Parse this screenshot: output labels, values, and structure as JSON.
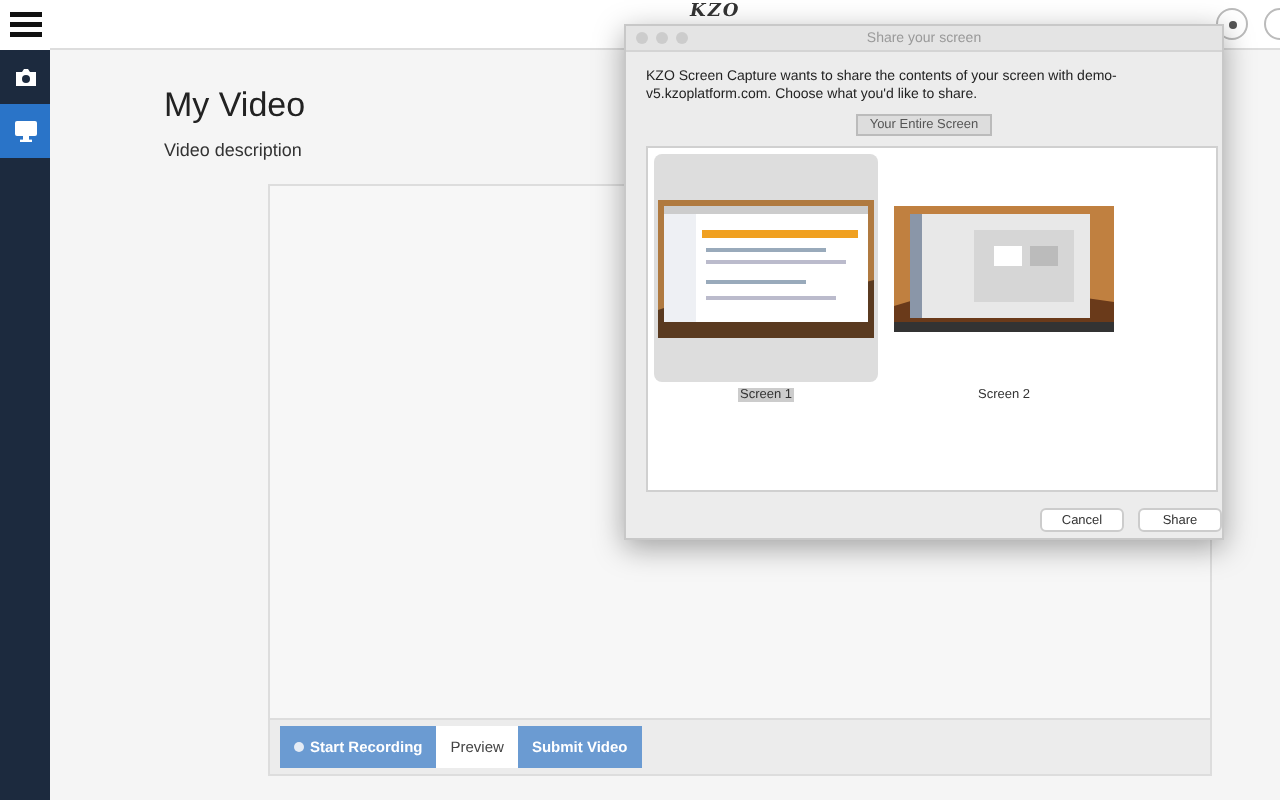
{
  "header": {
    "logo": "KZO"
  },
  "sidebar": {
    "items": [
      {
        "kind": "camera",
        "selected": false
      },
      {
        "kind": "monitor",
        "selected": true
      }
    ]
  },
  "main": {
    "title": "My Video",
    "description": "Video description",
    "buttons": [
      {
        "label": "Start Recording",
        "kind": "record"
      },
      {
        "label": "Preview",
        "kind": "plain"
      },
      {
        "label": "Submit Video",
        "kind": "primary"
      }
    ]
  },
  "dialog": {
    "title": "Share your screen",
    "message": "KZO Screen Capture wants to share the contents of your screen with demo-v5.kzoplatform.com. Choose what you'd like to share.",
    "tab": "Your Entire Screen",
    "screens": [
      {
        "label": "Screen 1",
        "selected": true
      },
      {
        "label": "Screen 2",
        "selected": false
      }
    ],
    "buttons": [
      "Cancel",
      "Share"
    ]
  }
}
